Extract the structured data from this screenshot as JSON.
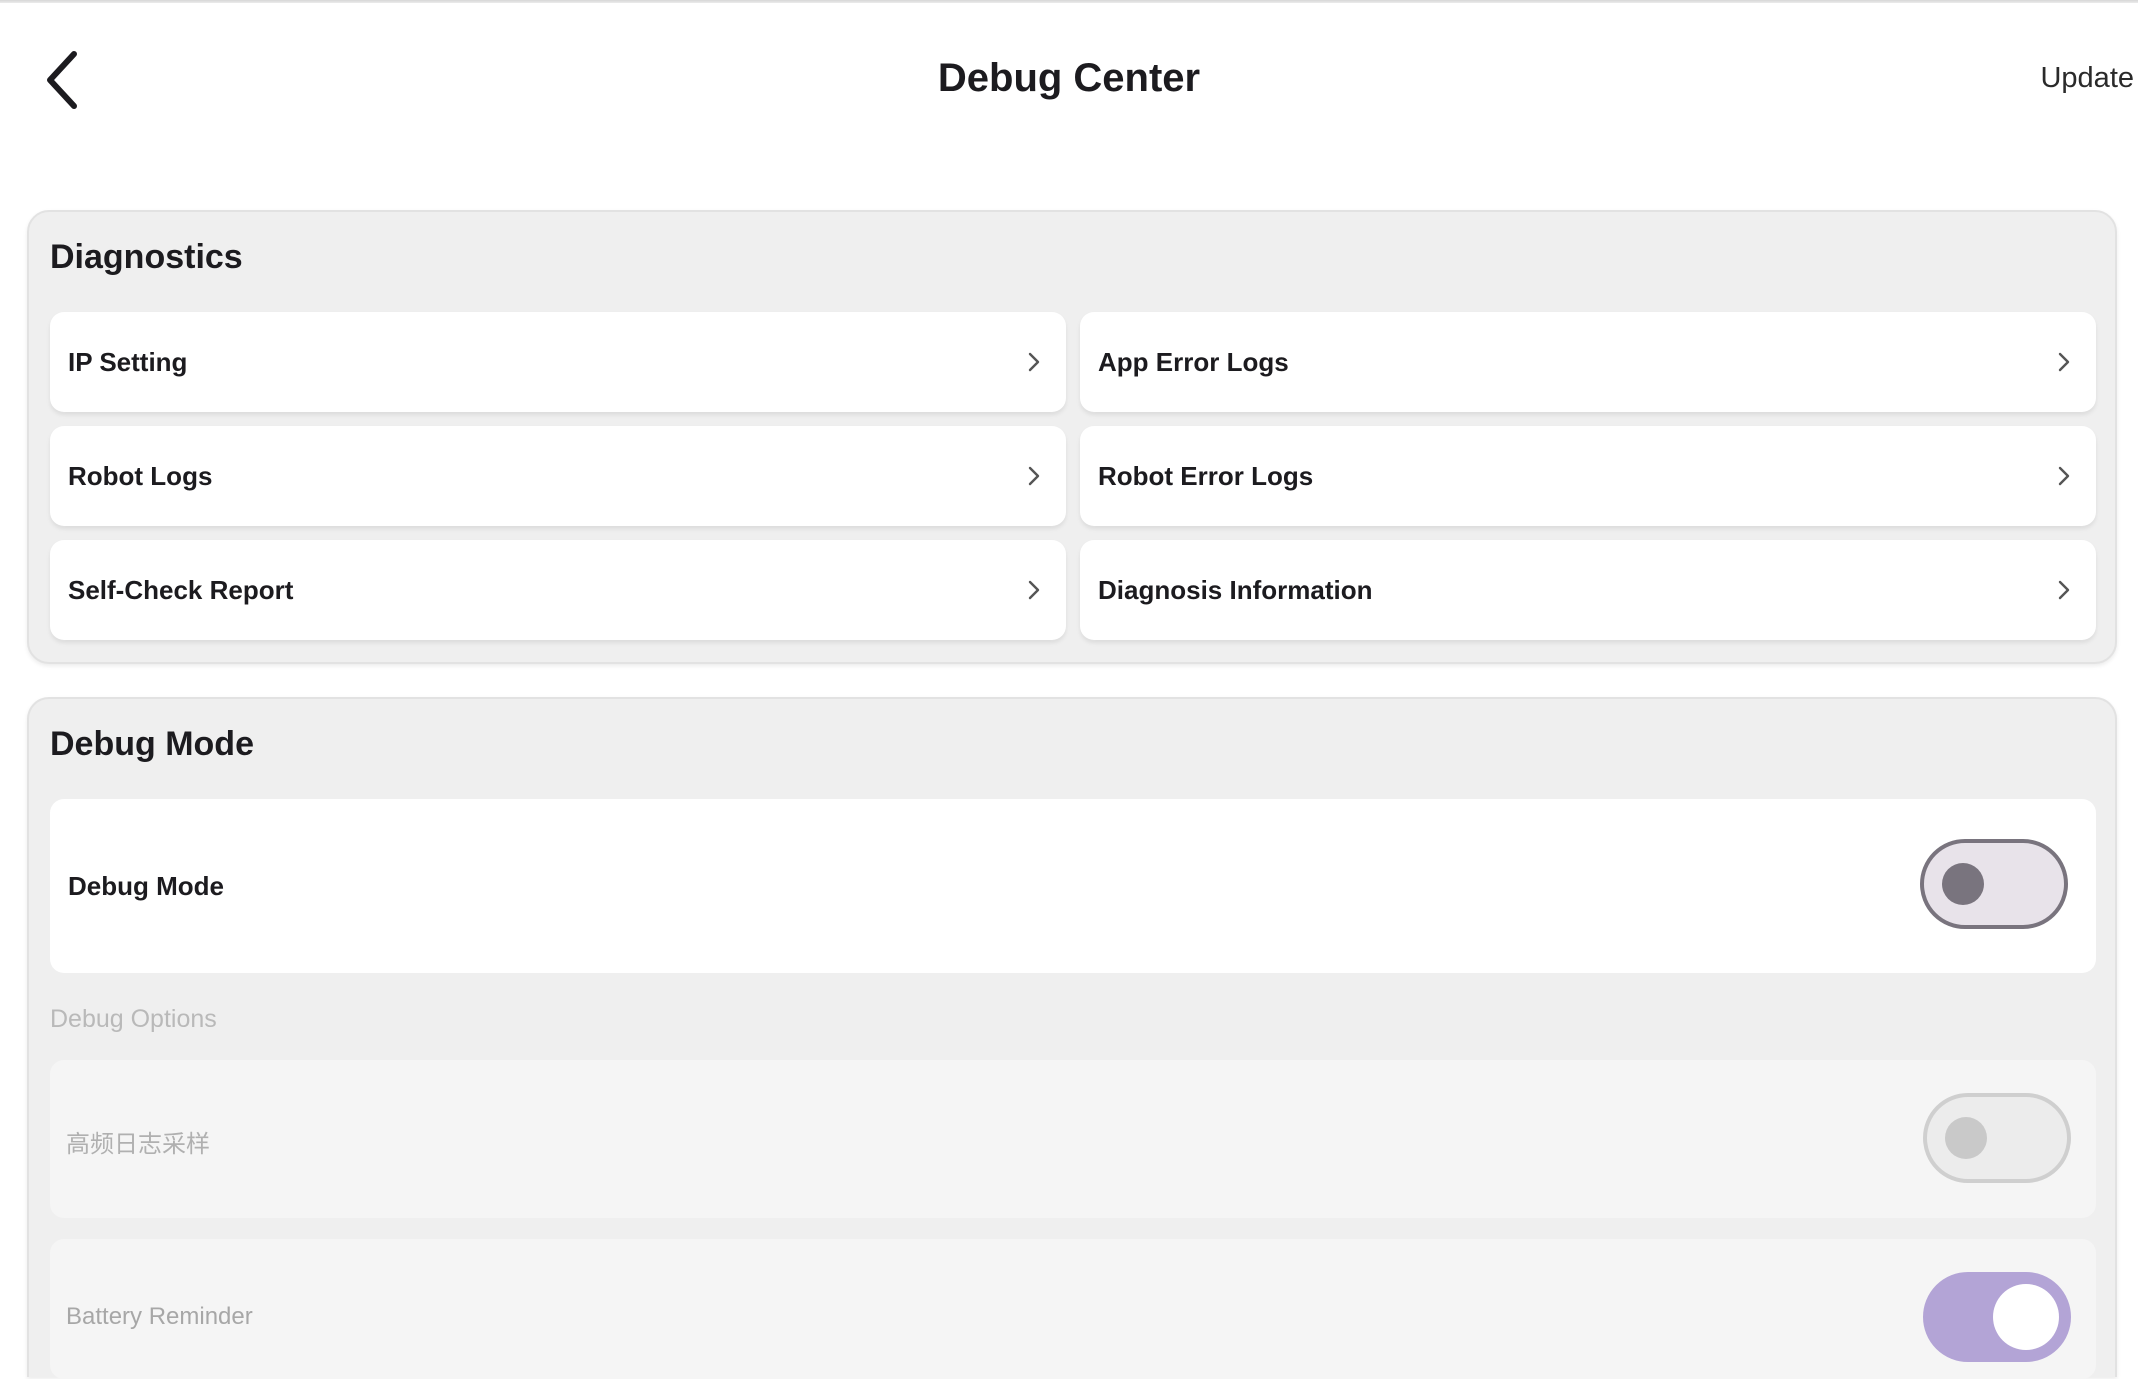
{
  "header": {
    "title": "Debug Center",
    "update_label": "Update"
  },
  "diagnostics": {
    "title": "Diagnostics",
    "items": [
      {
        "label": "IP Setting"
      },
      {
        "label": "App Error Logs"
      },
      {
        "label": "Robot Logs"
      },
      {
        "label": "Robot Error Logs"
      },
      {
        "label": "Self-Check Report"
      },
      {
        "label": "Diagnosis Information"
      }
    ]
  },
  "debug_mode": {
    "title": "Debug Mode",
    "toggle_label": "Debug Mode",
    "toggle_on": false,
    "options_title": "Debug Options",
    "options": [
      {
        "label": "高频日志采样",
        "on": false,
        "disabled": true
      },
      {
        "label": "Battery Reminder",
        "on": true,
        "disabled": true
      }
    ]
  },
  "colors": {
    "accent": "#b3a4d6",
    "card_bg": "#efefef",
    "row_bg": "#ffffff",
    "disabled_text": "#b9b9b9"
  }
}
